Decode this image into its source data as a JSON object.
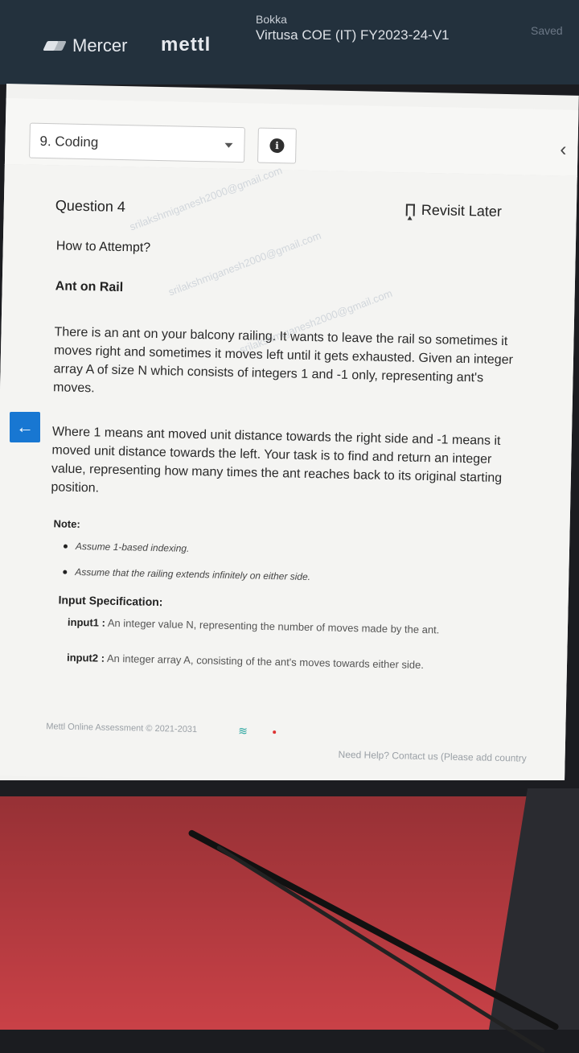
{
  "header": {
    "brand": "Mercer",
    "product": "mettl",
    "candidate": "Bokka",
    "test_name": "Virtusa COE (IT) FY2023-24-V1",
    "save_status": "Saved"
  },
  "question_nav": {
    "selected": "9. Coding",
    "info_icon": "info-icon",
    "collapse_icon": "chevron-left-icon"
  },
  "question": {
    "number_label": "Question 4",
    "revisit_label": "Revisit Later",
    "how_to_attempt": "How to Attempt?",
    "title": "Ant on Rail",
    "paragraph1": "There is an ant on your balcony railing. It wants to leave the rail so sometimes it moves right and sometimes it moves left until it gets exhausted. Given an integer array A of size N which consists of integers 1 and -1 only, representing ant's moves.",
    "paragraph2": "Where 1 means ant moved unit distance towards the right side and -1 means it moved unit distance towards the left. Your task is to find and return an integer value, representing how many times the ant reaches back to its original starting position.",
    "note_label": "Note:",
    "notes": [
      "Assume 1-based indexing.",
      "Assume that the railing extends infinitely on either side."
    ],
    "input_spec_label": "Input Specification:",
    "inputs": [
      {
        "name": "input1 :",
        "desc": "An integer value N, representing the number of moves made by the ant."
      },
      {
        "name": "input2 :",
        "desc": "An integer array A, consisting of the ant's moves towards either side."
      }
    ]
  },
  "footer": {
    "copyright": "Mettl Online Assessment © 2021-2031",
    "help": "Need Help? Contact us (Please add country"
  },
  "watermark_text": "srilakshmiganesh2000@gmail.com",
  "colors": {
    "header_bg": "#23313d",
    "accent": "#1877d2",
    "desk": "#c94147"
  }
}
